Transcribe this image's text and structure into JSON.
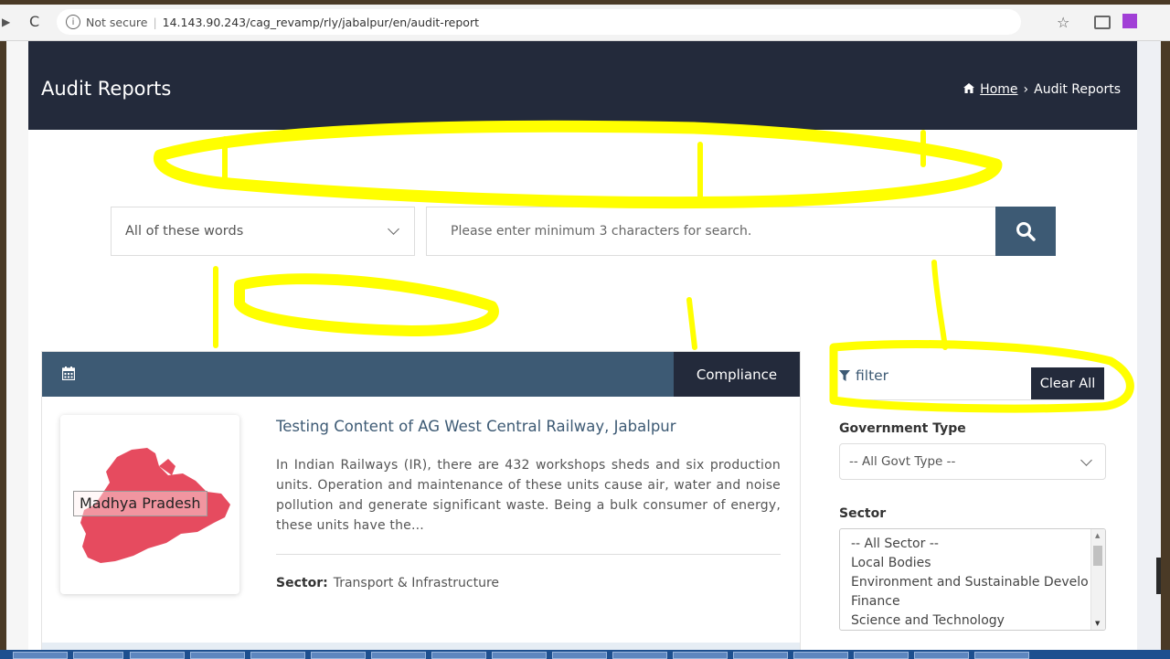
{
  "browser": {
    "security_label": "Not secure",
    "separator": "|",
    "url": "14.143.90.243/cag_revamp/rly/jabalpur/en/audit-report",
    "icons": [
      "back-icon",
      "reload-icon",
      "info-icon",
      "star-icon",
      "camera-icon",
      "extension-icon"
    ]
  },
  "header": {
    "title": "Audit Reports",
    "breadcrumb_home": "Home",
    "breadcrumb_sep": "›",
    "breadcrumb_current": "Audit Reports"
  },
  "search": {
    "mode_selected": "All of these words",
    "placeholder": "Please enter minimum 3 characters for search."
  },
  "report": {
    "category": "Compliance",
    "state_label": "Madhya Pradesh",
    "title": "Testing Content of AG West Central Railway, Jabalpur",
    "description": "In Indian Railways (IR), there are 432 workshops sheds and six production units. Operation and maintenance of these units cause air, water and noise pollution and generate significant waste. Being a bulk consumer of energy, these units have the...",
    "sector_label": "Sector:",
    "sector_value": "Transport & Infrastructure"
  },
  "filter": {
    "title": "filter",
    "clear_label": "Clear All",
    "govt_type_label": "Government Type",
    "govt_type_selected": "-- All Govt Type --",
    "sector_label": "Sector",
    "sector_options": [
      "-- All Sector --",
      "Local Bodies",
      "Environment and Sustainable Develo",
      "Finance",
      "Science and Technology"
    ]
  },
  "colors": {
    "header_bg": "#232a3b",
    "accent": "#3d5a74",
    "map_fill": "#e64b5f",
    "annotation": "#ffff00"
  }
}
